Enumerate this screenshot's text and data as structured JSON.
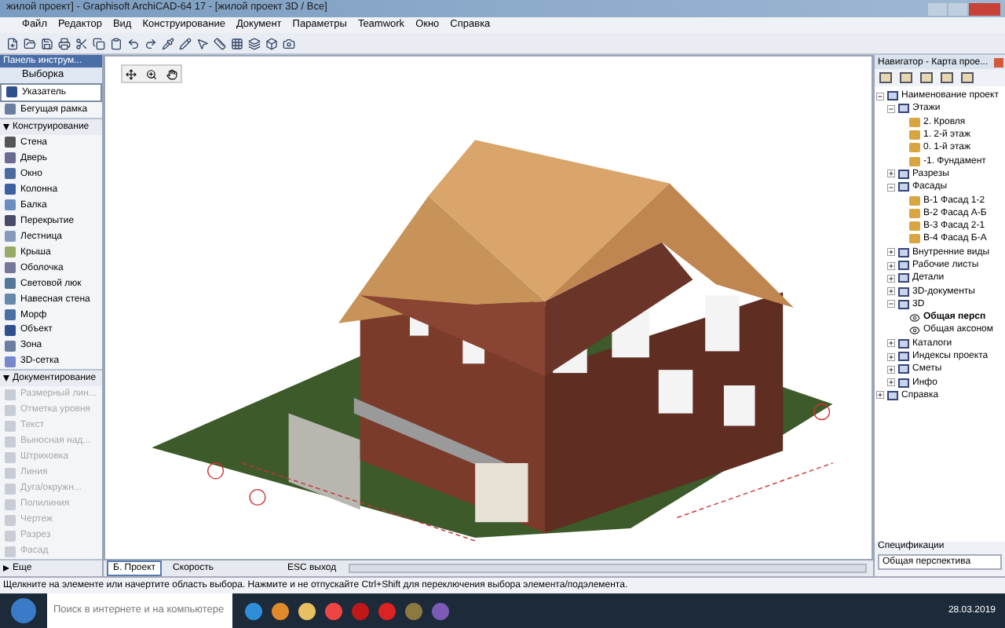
{
  "window": {
    "title": "жилой проект] - Graphisoft ArchiCAD-64 17 - [жилой проект 3D / Все]"
  },
  "menu": [
    "Файл",
    "Редактор",
    "Вид",
    "Конструирование",
    "Документ",
    "Параметры",
    "Teamwork",
    "Окно",
    "Справка"
  ],
  "toolbox": {
    "title": "Панель инструм...",
    "items": [
      {
        "kind": "header",
        "label": "Выборка"
      },
      {
        "kind": "tool",
        "label": "Указатель",
        "selected": true,
        "disabled": false
      },
      {
        "kind": "tool",
        "label": "Бегущая рамка",
        "selected": false,
        "disabled": false
      },
      {
        "kind": "section",
        "label": "Конструирование",
        "expanded": true
      },
      {
        "kind": "tool",
        "label": "Стена",
        "selected": false,
        "disabled": false
      },
      {
        "kind": "tool",
        "label": "Дверь",
        "selected": false,
        "disabled": false
      },
      {
        "kind": "tool",
        "label": "Окно",
        "selected": false,
        "disabled": false
      },
      {
        "kind": "tool",
        "label": "Колонна",
        "selected": false,
        "disabled": false
      },
      {
        "kind": "tool",
        "label": "Балка",
        "selected": false,
        "disabled": false
      },
      {
        "kind": "tool",
        "label": "Перекрытие",
        "selected": false,
        "disabled": false
      },
      {
        "kind": "tool",
        "label": "Лестница",
        "selected": false,
        "disabled": false
      },
      {
        "kind": "tool",
        "label": "Крыша",
        "selected": false,
        "disabled": false
      },
      {
        "kind": "tool",
        "label": "Оболочка",
        "selected": false,
        "disabled": false
      },
      {
        "kind": "tool",
        "label": "Световой люк",
        "selected": false,
        "disabled": false
      },
      {
        "kind": "tool",
        "label": "Навесная стена",
        "selected": false,
        "disabled": false
      },
      {
        "kind": "tool",
        "label": "Морф",
        "selected": false,
        "disabled": false
      },
      {
        "kind": "tool",
        "label": "Объект",
        "selected": false,
        "disabled": false
      },
      {
        "kind": "tool",
        "label": "Зона",
        "selected": false,
        "disabled": false
      },
      {
        "kind": "tool",
        "label": "3D-сетка",
        "selected": false,
        "disabled": false
      },
      {
        "kind": "section",
        "label": "Документирование",
        "expanded": true
      },
      {
        "kind": "tool",
        "label": "Размерный лин...",
        "selected": false,
        "disabled": true
      },
      {
        "kind": "tool",
        "label": "Отметка уровня",
        "selected": false,
        "disabled": true
      },
      {
        "kind": "tool",
        "label": "Текст",
        "selected": false,
        "disabled": true
      },
      {
        "kind": "tool",
        "label": "Выносная над...",
        "selected": false,
        "disabled": true
      },
      {
        "kind": "tool",
        "label": "Штриховка",
        "selected": false,
        "disabled": true
      },
      {
        "kind": "tool",
        "label": "Линия",
        "selected": false,
        "disabled": true
      },
      {
        "kind": "tool",
        "label": "Дуга/окружн...",
        "selected": false,
        "disabled": true
      },
      {
        "kind": "tool",
        "label": "Полилиния",
        "selected": false,
        "disabled": true
      },
      {
        "kind": "tool",
        "label": "Чертеж",
        "selected": false,
        "disabled": true
      },
      {
        "kind": "tool",
        "label": "Разрез",
        "selected": false,
        "disabled": true
      },
      {
        "kind": "tool",
        "label": "Фасад",
        "selected": false,
        "disabled": true
      },
      {
        "kind": "section",
        "label": "Еще",
        "expanded": false
      }
    ]
  },
  "view_tabs": [
    {
      "label": "Б. Проект",
      "selected": true
    },
    {
      "label": "Скорость",
      "selected": false
    }
  ],
  "view_hint": "ESC выход",
  "navigator": {
    "title": "Навигатор - Карта прое...",
    "tree": [
      {
        "kind": "group",
        "label": "Наименование проект",
        "expanded": true,
        "selected": false,
        "children": [
          {
            "kind": "group",
            "label": "Этажи",
            "expanded": true,
            "selected": false,
            "children": [
              {
                "kind": "story",
                "label": "2. Кровля",
                "selected": false
              },
              {
                "kind": "story",
                "label": "1. 2-й этаж",
                "selected": false
              },
              {
                "kind": "story",
                "label": "0. 1-й этаж",
                "selected": false
              },
              {
                "kind": "story",
                "label": "-1. Фундамент",
                "selected": false
              }
            ]
          },
          {
            "kind": "group",
            "label": "Разрезы",
            "expanded": false,
            "selected": false
          },
          {
            "kind": "group",
            "label": "Фасады",
            "expanded": true,
            "selected": false,
            "children": [
              {
                "kind": "story",
                "label": "В-1 Фасад 1-2",
                "selected": false
              },
              {
                "kind": "story",
                "label": "В-2 Фасад А-Б",
                "selected": false
              },
              {
                "kind": "story",
                "label": "В-3 Фасад 2-1",
                "selected": false
              },
              {
                "kind": "story",
                "label": "В-4 Фасад Б-А",
                "selected": false
              }
            ]
          },
          {
            "kind": "group",
            "label": "Внутренние виды",
            "expanded": false,
            "selected": false
          },
          {
            "kind": "group",
            "label": "Рабочие листы",
            "expanded": false,
            "selected": false
          },
          {
            "kind": "group",
            "label": "Детали",
            "expanded": false,
            "selected": false
          },
          {
            "kind": "group",
            "label": "3D-документы",
            "expanded": false,
            "selected": false
          },
          {
            "kind": "group",
            "label": "3D",
            "expanded": true,
            "selected": false,
            "children": [
              {
                "kind": "view3d",
                "label": "Общая персп",
                "selected": true
              },
              {
                "kind": "view3d",
                "label": "Общая аксоном",
                "selected": false
              }
            ]
          },
          {
            "kind": "group",
            "label": "Каталоги",
            "expanded": false,
            "selected": false
          },
          {
            "kind": "group",
            "label": "Индексы проекта",
            "expanded": false,
            "selected": false
          },
          {
            "kind": "group",
            "label": "Сметы",
            "expanded": false,
            "selected": false
          },
          {
            "kind": "group",
            "label": "Инфо",
            "expanded": false,
            "selected": false
          }
        ]
      },
      {
        "kind": "group",
        "label": "Справка",
        "expanded": false,
        "selected": false
      }
    ],
    "specs_label": "Спецификации",
    "view_field": "Общая перспектива"
  },
  "status_bar": "Щелкните на элементе или начертите область выбора. Нажмите и не отпускайте Ctrl+Shift для переключения выбора элемента/подэлемента.",
  "taskbar": {
    "search_placeholder": "Поиск в интернете и на компьютере",
    "date": "28.03.2019"
  }
}
